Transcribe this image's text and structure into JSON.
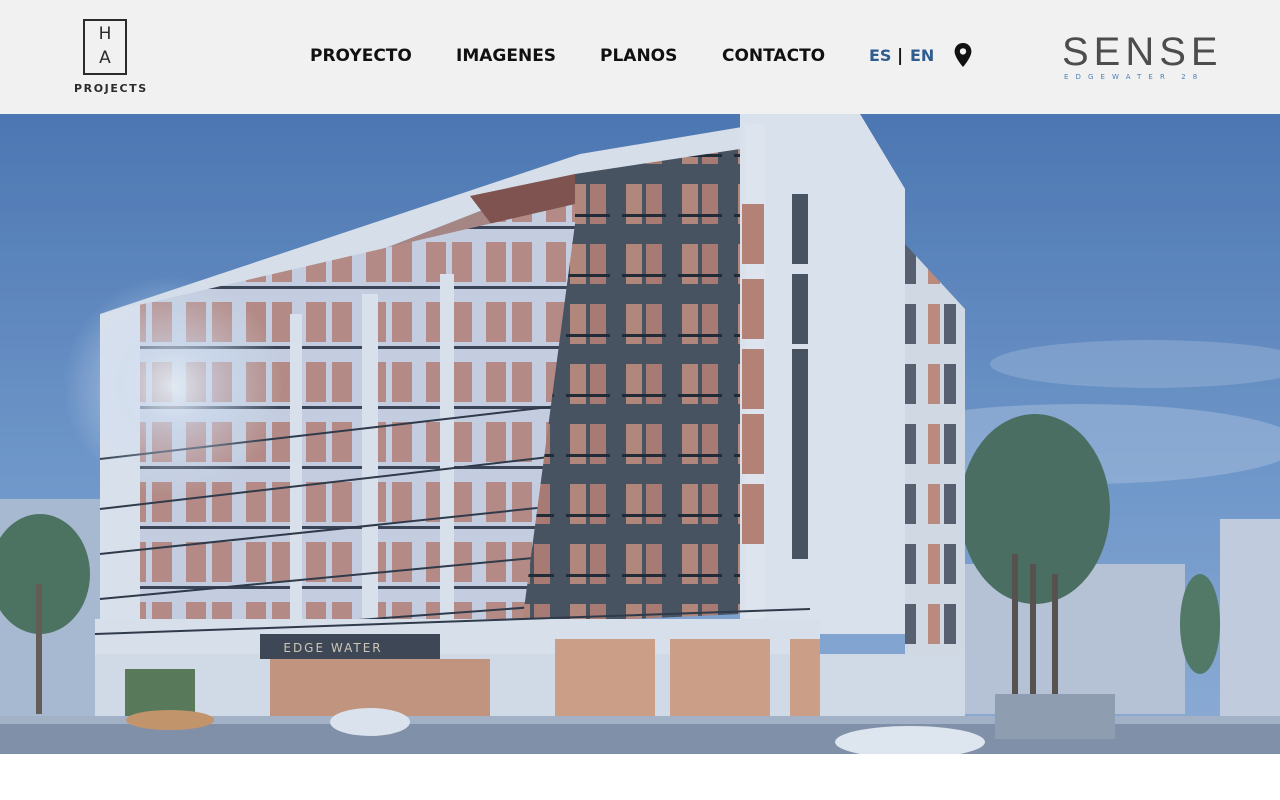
{
  "header": {
    "logo_left": {
      "top": "H",
      "bottom": "A",
      "sub": "PROJECTS"
    },
    "nav": [
      {
        "label": "PROYECTO"
      },
      {
        "label": "IMAGENES"
      },
      {
        "label": "PLANOS"
      },
      {
        "label": "CONTACTO"
      }
    ],
    "lang": {
      "es": "ES",
      "sep": "|",
      "en": "EN"
    },
    "location_icon": "map-pin-icon",
    "logo_right": {
      "word": "SENSE",
      "sub": "EDGEWATER 28"
    }
  },
  "hero": {
    "sign": "EDGE WATER"
  },
  "colors": {
    "header_bg": "#f1f1f1",
    "lang_accent": "#2f5d8f",
    "sense_sub": "#4b7fb8",
    "sky": "#6f93c8"
  }
}
